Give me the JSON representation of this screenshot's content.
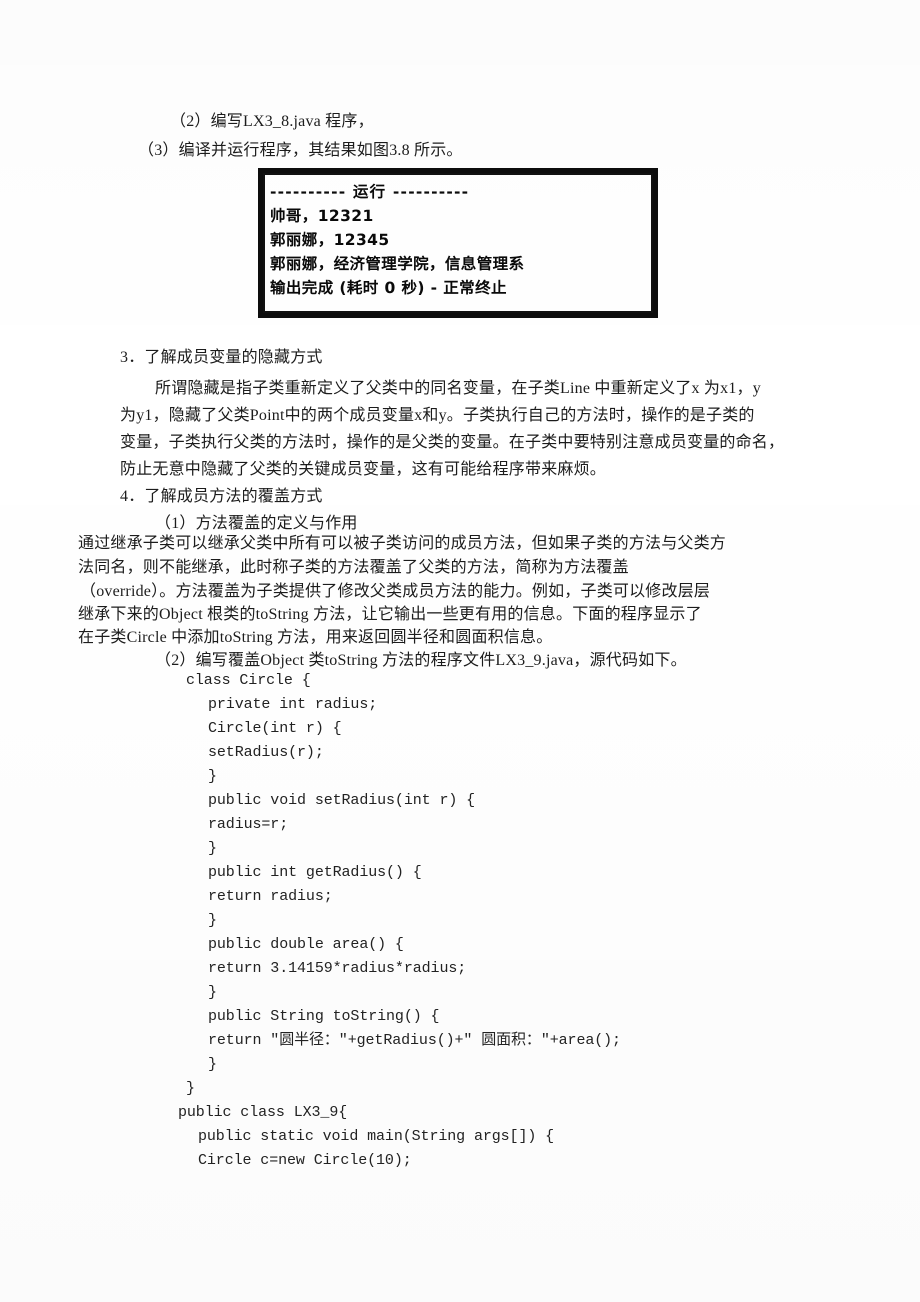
{
  "document": {
    "page_background": "#ffffff",
    "text_color": "#1c1c1c"
  },
  "intro": {
    "line1": "（2）编写LX3_8.java 程序，",
    "line2": "（3）编译并运行程序，其结果如图3.8 所示。"
  },
  "console_figure": {
    "border_color": "#0d0d0d",
    "screen_color": "#ffffff",
    "lines": [
      "---------- 运行 ----------",
      "帅哥，12321",
      "郭丽娜，12345",
      "郭丽娜，经济管理学院，信息管理系",
      "输出完成 (耗时 0 秒) - 正常终止"
    ]
  },
  "section3": {
    "heading": "3．了解成员变量的隐藏方式",
    "paragraph_lines": [
      "所谓隐藏是指子类重新定义了父类中的同名变量，在子类Line 中重新定义了x 为x1，y",
      "为y1，隐藏了父类Point中的两个成员变量x和y。子类执行自己的方法时，操作的是子类的",
      "变量，子类执行父类的方法时，操作的是父类的变量。在子类中要特别注意成员变量的命名，",
      "防止无意中隐藏了父类的关键成员变量，这有可能给程序带来麻烦。"
    ]
  },
  "section4": {
    "heading": "4．了解成员方法的覆盖方式",
    "sub1_heading": "（1）方法覆盖的定义与作用",
    "paragraph_lines": [
      "通过继承子类可以继承父类中所有可以被子类访问的成员方法，但如果子类的方法与父类方",
      "法同名，则不能继承，此时称子类的方法覆盖了父类的方法，简称为方法覆盖",
      "（override）。方法覆盖为子类提供了修改父类成员方法的能力。例如，子类可以修改层层",
      "继承下来的Object 根类的toString 方法，让它输出一些更有用的信息。下面的程序显示了",
      "在子类Circle 中添加toString 方法，用来返回圆半径和圆面积信息。"
    ],
    "sub2_heading": "（2）编写覆盖Object 类toString 方法的程序文件LX3_9.java，源代码如下。"
  },
  "code_listing": {
    "language": "java",
    "lines": [
      {
        "text": "class Circle {",
        "indent": 0
      },
      {
        "text": "private int radius;",
        "indent": 1
      },
      {
        "text": "Circle(int r) {",
        "indent": 1
      },
      {
        "text": "setRadius(r);",
        "indent": 1
      },
      {
        "text": "}",
        "indent": 1
      },
      {
        "text": "public void setRadius(int r) {",
        "indent": 1
      },
      {
        "text": "radius=r;",
        "indent": 1
      },
      {
        "text": "}",
        "indent": 1
      },
      {
        "text": "public int getRadius() {",
        "indent": 1
      },
      {
        "text": "return radius;",
        "indent": 1
      },
      {
        "text": "}",
        "indent": 1
      },
      {
        "text": "public double area() {",
        "indent": 1
      },
      {
        "text": "return 3.14159*radius*radius;",
        "indent": 1
      },
      {
        "text": "}",
        "indent": 1
      },
      {
        "text": "public String toString() {",
        "indent": 1
      },
      {
        "text": "return \"圆半径：\"+getRadius()+\" 圆面积：\"+area();",
        "indent": 1
      },
      {
        "text": "}",
        "indent": 1
      },
      {
        "text": "}",
        "indent": 0
      },
      {
        "text": "public class LX3_9{",
        "indent": -1
      },
      {
        "text": "public static void main(String args[]) {",
        "indent": 0
      },
      {
        "text": "Circle c=new Circle(10);",
        "indent": 0
      }
    ]
  }
}
